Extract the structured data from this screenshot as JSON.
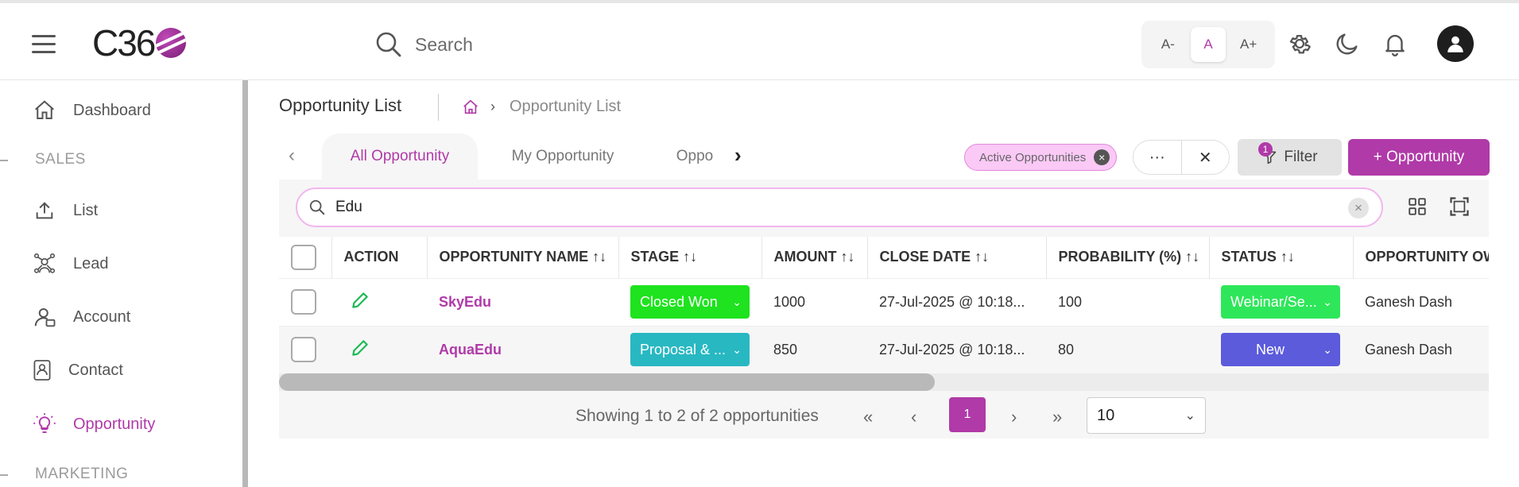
{
  "header": {
    "logo_text": "C36",
    "search_label": "Search",
    "font_controls": [
      "A-",
      "A",
      "A+"
    ],
    "active_font_control": "A"
  },
  "sidebar": {
    "items": [
      {
        "label": "Dashboard",
        "icon": "home-icon"
      },
      {
        "label": "List",
        "icon": "upload-icon"
      },
      {
        "label": "Lead",
        "icon": "network-icon"
      },
      {
        "label": "Account",
        "icon": "user-account-icon"
      },
      {
        "label": "Contact",
        "icon": "contact-card-icon"
      },
      {
        "label": "Opportunity",
        "icon": "lightbulb-icon",
        "active": true
      }
    ],
    "sections": [
      "SALES",
      "MARKETING"
    ]
  },
  "page": {
    "title": "Opportunity List",
    "breadcrumb_current": "Opportunity List"
  },
  "tabs": [
    "All Opportunity",
    "My Opportunity",
    "Oppo"
  ],
  "active_tab": "All Opportunity",
  "toolbar": {
    "chip_label": "Active Opportunities",
    "more_label": "···",
    "close_label": "✕",
    "filter_label": "Filter",
    "filter_count": "1",
    "add_label": "+ Opportunity"
  },
  "search": {
    "value": "Edu"
  },
  "table": {
    "headers": [
      "ACTION",
      "OPPORTUNITY NAME ↑↓",
      "STAGE ↑↓",
      "AMOUNT ↑↓",
      "CLOSE DATE ↑↓",
      "PROBABILITY (%) ↑↓",
      "STATUS ↑↓",
      "OPPORTUNITY OW"
    ],
    "rows": [
      {
        "name": "SkyEdu",
        "stage": "Closed Won",
        "stage_color": "#1ee31e",
        "amount": "1000",
        "close_date": "27-Jul-2025 @ 10:18...",
        "probability": "100",
        "status": "Webinar/Se...",
        "status_color": "#2ee65a",
        "owner": "Ganesh Dash"
      },
      {
        "name": "AquaEdu",
        "stage": "Proposal & ...",
        "stage_color": "#28b8c2",
        "amount": "850",
        "close_date": "27-Jul-2025 @ 10:18...",
        "probability": "80",
        "status": "New",
        "status_color": "#5b5bdc",
        "owner": "Ganesh Dash"
      }
    ]
  },
  "pagination": {
    "summary": "Showing 1 to 2 of 2 opportunities",
    "current_page": "1",
    "page_size": "10"
  },
  "colors": {
    "accent": "#b03aa8"
  }
}
